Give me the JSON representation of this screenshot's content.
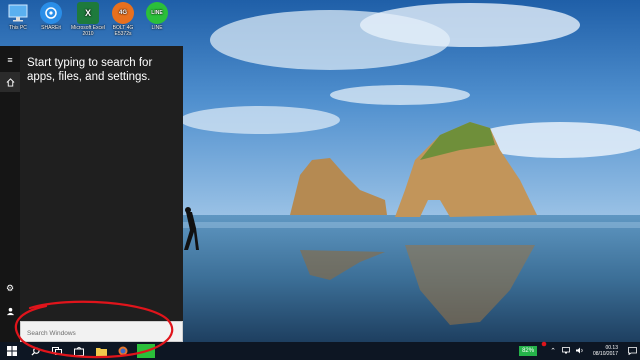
{
  "desktop_icons": [
    {
      "label": "This PC",
      "icon": "this-pc-icon"
    },
    {
      "label": "SHAREit",
      "icon": "shareit-icon"
    },
    {
      "label": "Microsoft Excel 2010",
      "icon": "excel-icon"
    },
    {
      "label": "BOLT 4G E5372s",
      "icon": "bolt-modem-icon"
    },
    {
      "label": "LINE",
      "icon": "line-app-icon"
    }
  ],
  "start_menu": {
    "hint_text": "Start typing to search for apps, files, and settings.",
    "search_placeholder": "Search Windows"
  },
  "tray": {
    "battery": "82%",
    "time": "00.13",
    "date": "08/10/2017"
  },
  "colors": {
    "start_menu_bg": "#1f1f1f",
    "taskbar_bg": "#0d1623",
    "battery_green": "#25b34a",
    "annotation_red": "#e0141b"
  }
}
